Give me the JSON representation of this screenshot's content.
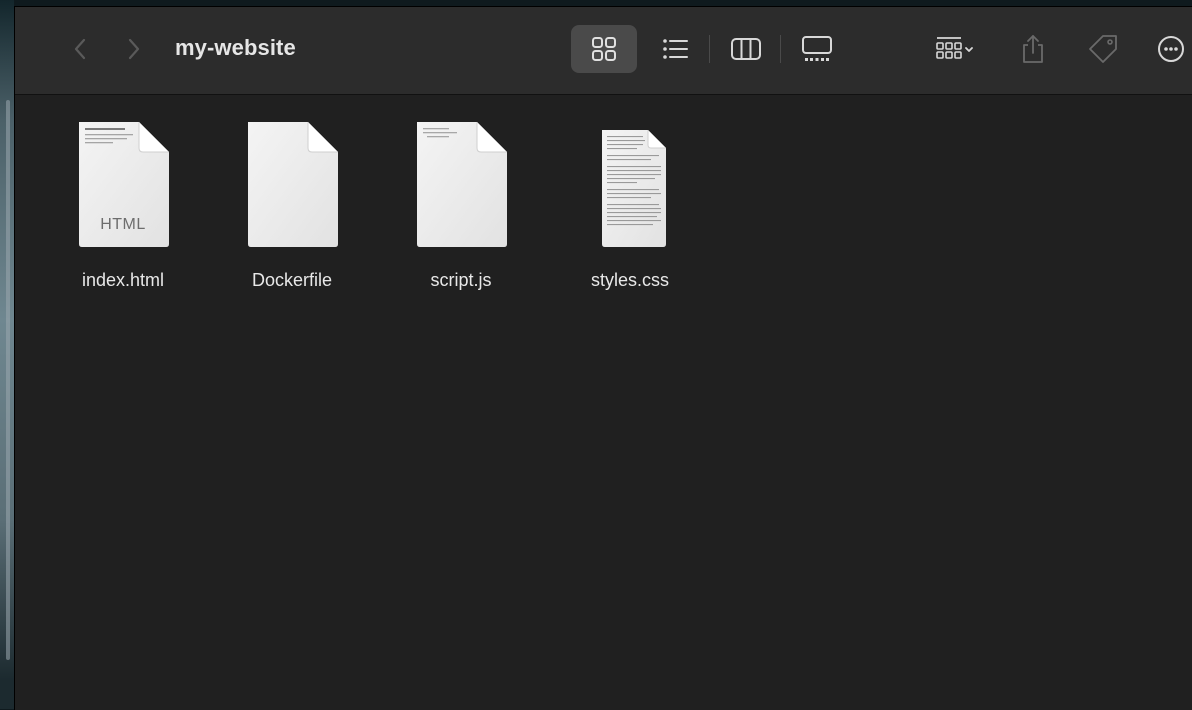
{
  "window": {
    "title": "my-website"
  },
  "toolbar": {
    "back_icon": "chevron-left-icon",
    "forward_icon": "chevron-right-icon",
    "view_modes": [
      {
        "name": "icon-view",
        "icon": "grid-icon",
        "active": true
      },
      {
        "name": "list-view",
        "icon": "list-icon",
        "active": false
      },
      {
        "name": "column-view",
        "icon": "columns-icon",
        "active": false
      },
      {
        "name": "gallery-view",
        "icon": "gallery-icon",
        "active": false
      }
    ],
    "group_icon": "group-by-icon",
    "share_icon": "share-icon",
    "tag_icon": "tag-icon",
    "more_icon": "more-icon"
  },
  "files": [
    {
      "name": "index.html",
      "badge": "HTML",
      "preview": "html"
    },
    {
      "name": "Dockerfile",
      "badge": "",
      "preview": "blank"
    },
    {
      "name": "script.js",
      "badge": "",
      "preview": "js"
    },
    {
      "name": "styles.css",
      "badge": "",
      "preview": "css"
    }
  ],
  "colors": {
    "window_bg": "#202020",
    "toolbar_bg": "#2c2c2c",
    "text": "#e8e8e8",
    "icon": "#d8d8d8",
    "icon_dim": "#6a6a6a"
  }
}
